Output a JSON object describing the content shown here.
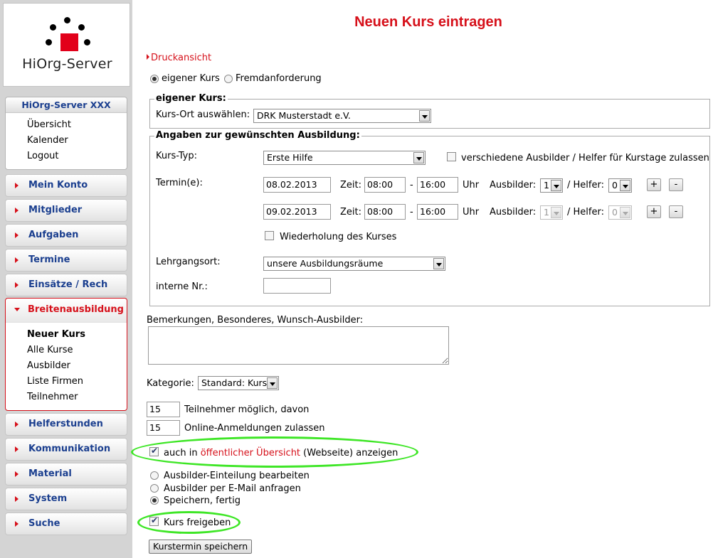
{
  "logo": {
    "text": "HiOrg-Server"
  },
  "sidebar": {
    "org_box": {
      "title": "HiOrg-Server XXX",
      "items": [
        "Übersicht",
        "Kalender",
        "Logout"
      ]
    },
    "menu": [
      {
        "label": "Mein Konto"
      },
      {
        "label": "Mitglieder"
      },
      {
        "label": "Aufgaben"
      },
      {
        "label": "Termine"
      },
      {
        "label": "Einsätze / Rech"
      }
    ],
    "active_section": {
      "label": "Breitenausbildung",
      "items": [
        "Neuer Kurs",
        "Alle Kurse",
        "Ausbilder",
        "Liste Firmen",
        "Teilnehmer"
      ]
    },
    "menu_after": [
      {
        "label": "Helferstunden"
      },
      {
        "label": "Kommunikation"
      },
      {
        "label": "Material"
      },
      {
        "label": "System"
      },
      {
        "label": "Suche"
      }
    ]
  },
  "main": {
    "title": "Neuen Kurs eintragen",
    "print_link": "Druckansicht",
    "course_source": {
      "options": [
        "eigener Kurs",
        "Fremdanforderung"
      ],
      "selected": "eigener Kurs"
    },
    "own_course": {
      "legend": "eigener Kurs:",
      "location_label": "Kurs-Ort auswählen:",
      "location_value": "DRK Musterstadt e.V."
    },
    "training": {
      "legend": "Angaben zur gewünschten Ausbildung:",
      "type_label": "Kurs-Typ:",
      "type_value": "Erste Hilfe",
      "multi_trainer_label": "verschiedene Ausbilder / Helfer für Kurstage zulassen",
      "multi_trainer_checked": false,
      "dates_label": "Termin(e):",
      "dates": [
        {
          "date": "08.02.2013",
          "time_label": "Zeit:",
          "from": "08:00",
          "dash": "-",
          "to": "16:00",
          "unit": "Uhr",
          "trainer_label": "Ausbilder:",
          "trainer": "1",
          "helper_label": "/ Helfer:",
          "helper": "0",
          "enabled": true
        },
        {
          "date": "09.02.2013",
          "time_label": "Zeit:",
          "from": "08:00",
          "dash": "-",
          "to": "16:00",
          "unit": "Uhr",
          "trainer_label": "Ausbilder:",
          "trainer": "1",
          "helper_label": "/ Helfer:",
          "helper": "0",
          "enabled": false
        }
      ],
      "plus": "+",
      "minus": "-",
      "repeat_label": "Wiederholung des Kurses",
      "repeat_checked": false,
      "venue_label": "Lehrgangsort:",
      "venue_value": "unsere Ausbildungsräume",
      "internal_label": "interne Nr.:",
      "internal_value": ""
    },
    "remarks_label": "Bemerkungen, Besonderes, Wunsch-Ausbilder:",
    "remarks_value": "",
    "category_label": "Kategorie:",
    "category_value": "Standard: Kurs",
    "participants": {
      "value": "15",
      "label": "Teilnehmer möglich, davon"
    },
    "online": {
      "value": "15",
      "label": "Online-Anmeldungen zulassen"
    },
    "public": {
      "prefix": "auch in ",
      "link": "öffentlicher Übersicht",
      "suffix": " (Webseite) anzeigen",
      "checked": true
    },
    "after_save": {
      "options": [
        "Ausbilder-Einteilung bearbeiten",
        "Ausbilder per E-Mail anfragen",
        "Speichern, fertig"
      ],
      "selected": "Speichern, fertig"
    },
    "release": {
      "label": "Kurs freigeben",
      "checked": true
    },
    "submit_label": "Kurstermin speichern"
  },
  "colors": {
    "accent_red": "#d6101a",
    "nav_blue": "#1b3f8f",
    "highlight_green": "#3ee626"
  }
}
